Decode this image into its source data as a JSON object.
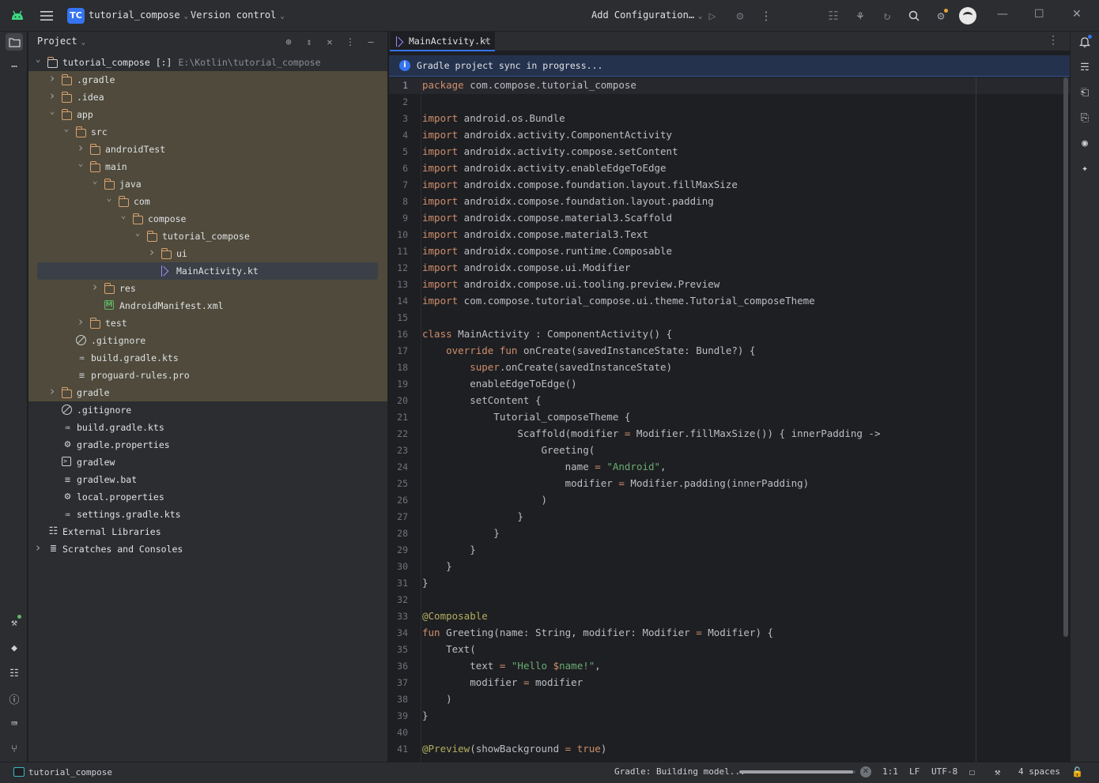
{
  "titlebar": {
    "project_badge": "TC",
    "project_name": "tutorial_compose",
    "version_control": "Version control",
    "add_configuration": "Add Configuration…",
    "accent_color": "#3574f0"
  },
  "project_panel": {
    "title": "Project",
    "tree": [
      {
        "label": "tutorial_compose [:]",
        "hint": "E:\\Kotlin\\tutorial_compose",
        "icon": "module-folder-icon",
        "expanded": true
      },
      {
        "label": ".gradle",
        "icon": "folder-icon",
        "expanded": false
      },
      {
        "label": ".idea",
        "icon": "folder-icon",
        "expanded": false
      },
      {
        "label": "app",
        "icon": "folder-icon",
        "expanded": true
      },
      {
        "label": "src",
        "icon": "folder-icon",
        "expanded": true
      },
      {
        "label": "androidTest",
        "icon": "folder-icon",
        "expanded": false
      },
      {
        "label": "main",
        "icon": "folder-icon",
        "expanded": true
      },
      {
        "label": "java",
        "icon": "folder-icon",
        "expanded": true
      },
      {
        "label": "com",
        "icon": "folder-icon",
        "expanded": true
      },
      {
        "label": "compose",
        "icon": "folder-icon",
        "expanded": true
      },
      {
        "label": "tutorial_compose",
        "icon": "folder-icon",
        "expanded": true
      },
      {
        "label": "ui",
        "icon": "folder-icon",
        "expanded": false
      },
      {
        "label": "MainActivity.kt",
        "icon": "kotlin-file-icon",
        "selected": true
      },
      {
        "label": "res",
        "icon": "folder-icon",
        "expanded": false
      },
      {
        "label": "AndroidManifest.xml",
        "icon": "manifest-file-icon"
      },
      {
        "label": "test",
        "icon": "folder-icon",
        "expanded": false
      },
      {
        "label": ".gitignore",
        "icon": "gitignore-icon"
      },
      {
        "label": "build.gradle.kts",
        "icon": "gradle-kts-icon"
      },
      {
        "label": "proguard-rules.pro",
        "icon": "text-file-icon"
      },
      {
        "label": "gradle",
        "icon": "folder-icon",
        "expanded": false
      },
      {
        "label": ".gitignore",
        "icon": "gitignore-icon"
      },
      {
        "label": "build.gradle.kts",
        "icon": "gradle-kts-icon"
      },
      {
        "label": "gradle.properties",
        "icon": "settings-gear-icon"
      },
      {
        "label": "gradlew",
        "icon": "terminal-file-icon"
      },
      {
        "label": "gradlew.bat",
        "icon": "text-file-icon"
      },
      {
        "label": "local.properties",
        "icon": "settings-gear-icon"
      },
      {
        "label": "settings.gradle.kts",
        "icon": "gradle-kts-icon"
      },
      {
        "label": "External Libraries",
        "icon": "library-icon"
      },
      {
        "label": "Scratches and Consoles",
        "icon": "scratches-icon",
        "expanded": false
      }
    ]
  },
  "editor": {
    "tab_label": "MainActivity.kt",
    "banner": "Gradle project sync in progress...",
    "lines": [
      {
        "n": "1",
        "t": "package com.compose.tutorial_compose"
      },
      {
        "n": "2",
        "t": ""
      },
      {
        "n": "3",
        "t": "import android.os.Bundle"
      },
      {
        "n": "4",
        "t": "import androidx.activity.ComponentActivity"
      },
      {
        "n": "5",
        "t": "import androidx.activity.compose.setContent"
      },
      {
        "n": "6",
        "t": "import androidx.activity.enableEdgeToEdge"
      },
      {
        "n": "7",
        "t": "import androidx.compose.foundation.layout.fillMaxSize"
      },
      {
        "n": "8",
        "t": "import androidx.compose.foundation.layout.padding"
      },
      {
        "n": "9",
        "t": "import androidx.compose.material3.Scaffold"
      },
      {
        "n": "10",
        "t": "import androidx.compose.material3.Text"
      },
      {
        "n": "11",
        "t": "import androidx.compose.runtime.Composable"
      },
      {
        "n": "12",
        "t": "import androidx.compose.ui.Modifier"
      },
      {
        "n": "13",
        "t": "import androidx.compose.ui.tooling.preview.Preview"
      },
      {
        "n": "14",
        "t": "import com.compose.tutorial_compose.ui.theme.Tutorial_composeTheme"
      },
      {
        "n": "15",
        "t": ""
      },
      {
        "n": "16",
        "t": "class MainActivity : ComponentActivity() {"
      },
      {
        "n": "17",
        "t": "    override fun onCreate(savedInstanceState: Bundle?) {"
      },
      {
        "n": "18",
        "t": "        super.onCreate(savedInstanceState)"
      },
      {
        "n": "19",
        "t": "        enableEdgeToEdge()"
      },
      {
        "n": "20",
        "t": "        setContent {"
      },
      {
        "n": "21",
        "t": "            Tutorial_composeTheme {"
      },
      {
        "n": "22",
        "t": "                Scaffold(modifier = Modifier.fillMaxSize()) { innerPadding ->"
      },
      {
        "n": "23",
        "t": "                    Greeting("
      },
      {
        "n": "24",
        "t": "                        name = \"Android\","
      },
      {
        "n": "25",
        "t": "                        modifier = Modifier.padding(innerPadding)"
      },
      {
        "n": "26",
        "t": "                    )"
      },
      {
        "n": "27",
        "t": "                }"
      },
      {
        "n": "28",
        "t": "            }"
      },
      {
        "n": "29",
        "t": "        }"
      },
      {
        "n": "30",
        "t": "    }"
      },
      {
        "n": "31",
        "t": "}"
      },
      {
        "n": "32",
        "t": ""
      },
      {
        "n": "33",
        "t": "@Composable"
      },
      {
        "n": "34",
        "t": "fun Greeting(name: String, modifier: Modifier = Modifier) {"
      },
      {
        "n": "35",
        "t": "    Text("
      },
      {
        "n": "36",
        "t": "        text = \"Hello $name!\","
      },
      {
        "n": "37",
        "t": "        modifier = modifier"
      },
      {
        "n": "38",
        "t": "    )"
      },
      {
        "n": "39",
        "t": "}"
      },
      {
        "n": "40",
        "t": ""
      },
      {
        "n": "41",
        "t": "@Preview(showBackground = true)"
      }
    ],
    "syntax_colors": {
      "keyword": "#cf8e6d",
      "string": "#6aab73",
      "annotation": "#b3ae60",
      "text": "#bcbec4"
    }
  },
  "statusbar": {
    "project": "tutorial_compose",
    "task": "Gradle: Building model...",
    "progress": 0.98,
    "position": "1:1",
    "line_separator": "LF",
    "encoding": "UTF-8",
    "indent": "4 spaces"
  }
}
